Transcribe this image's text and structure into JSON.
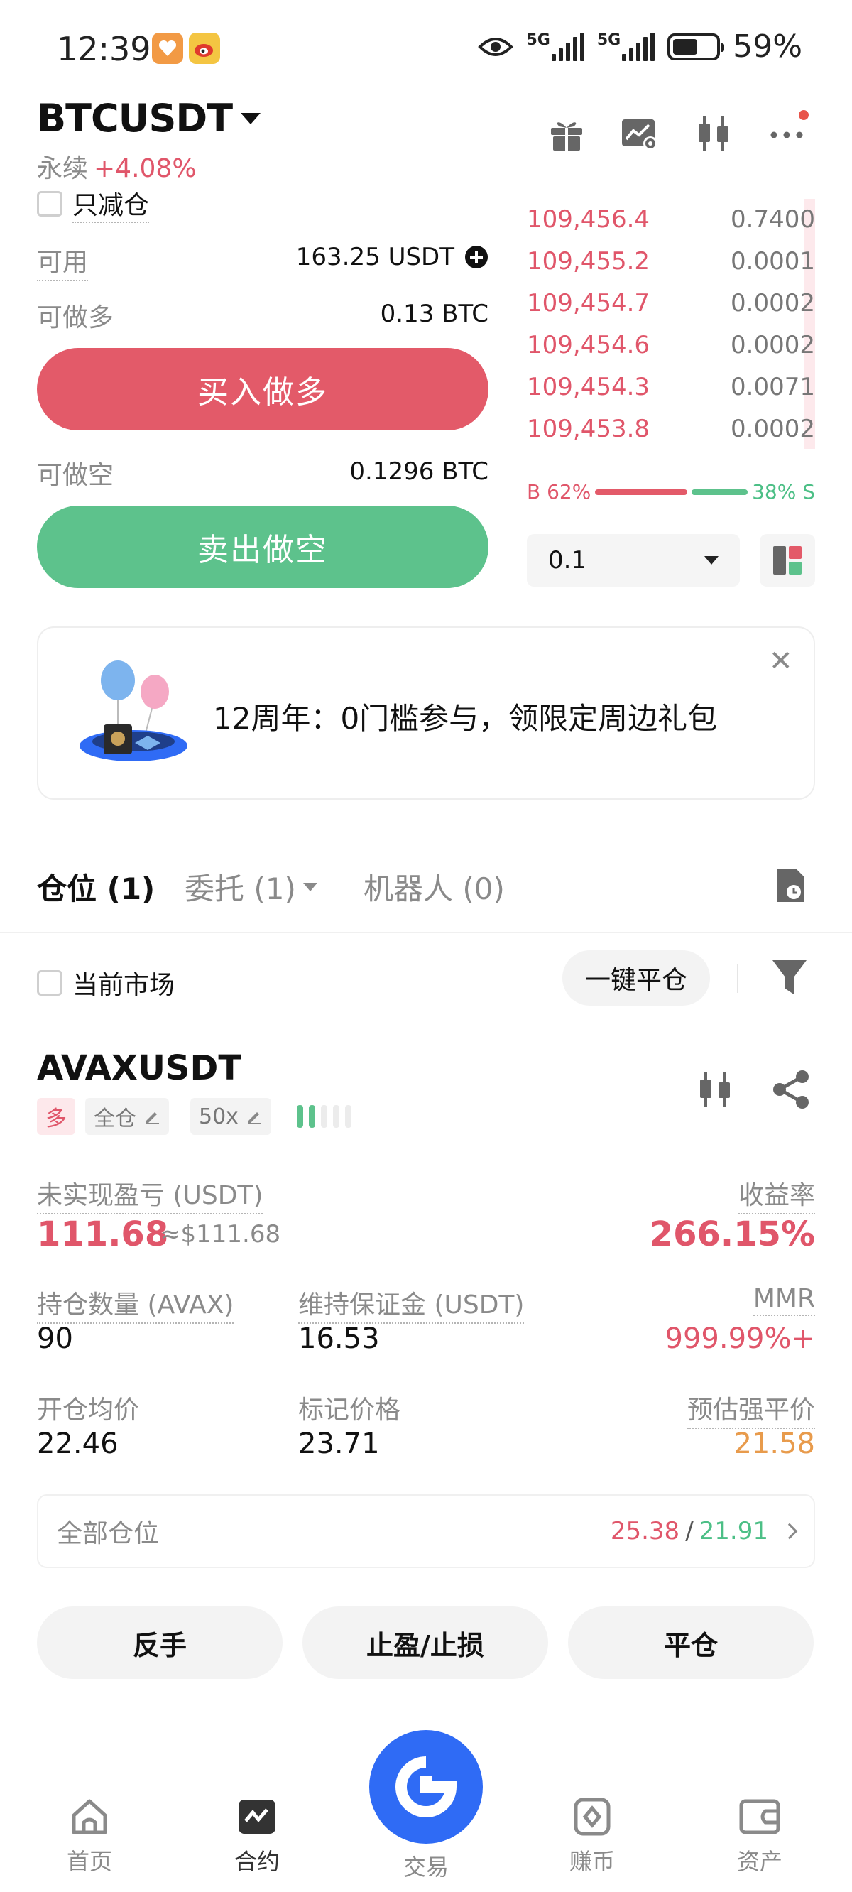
{
  "status_bar": {
    "time": "12:39",
    "network1": "5G",
    "network2": "5G",
    "battery": "59%",
    "battery_level": 0.59
  },
  "header": {
    "pair": "BTCUSDT",
    "contract_type": "永续",
    "change": "+4.08%"
  },
  "reduce_only": {
    "label": "只减仓",
    "checked": false
  },
  "balance": {
    "available_label": "可用",
    "available_value": "163.25 USDT",
    "long_label": "可做多",
    "long_value": "0.13 BTC",
    "short_label": "可做空",
    "short_value": "0.1296 BTC"
  },
  "buttons": {
    "buy": "买入做多",
    "sell": "卖出做空"
  },
  "order_book": {
    "asks": [
      {
        "price": "109,456.4",
        "qty": "0.7400"
      },
      {
        "price": "109,455.2",
        "qty": "0.0001"
      },
      {
        "price": "109,454.7",
        "qty": "0.0002"
      },
      {
        "price": "109,454.6",
        "qty": "0.0002"
      },
      {
        "price": "109,454.3",
        "qty": "0.0071"
      },
      {
        "price": "109,453.8",
        "qty": "0.0002"
      }
    ],
    "buy_ratio_label": "B 62%",
    "sell_ratio_label": "38% S",
    "buy_ratio": 0.62,
    "precision": "0.1"
  },
  "banner": {
    "text": "12周年：0门槛参与，领限定周边礼包"
  },
  "tabs": {
    "positions": "仓位 (1)",
    "orders": "委托 (1)",
    "bots": "机器人 (0)"
  },
  "filter": {
    "current_market": "当前市场",
    "close_all": "一键平仓"
  },
  "position": {
    "symbol": "AVAXUSDT",
    "side": "多",
    "margin_mode": "全仓",
    "leverage": "50x",
    "risk_level": 2,
    "risk_total": 5,
    "pnl_label": "未实现盈亏 (USDT)",
    "pnl_value": "111.68",
    "pnl_usd": "≈$111.68",
    "roe_label": "收益率",
    "roe_value": "266.15%",
    "size_label": "持仓数量 (AVAX)",
    "size_value": "90",
    "margin_label": "维持保证金 (USDT)",
    "margin_value": "16.53",
    "mmr_label": "MMR",
    "mmr_value": "999.99%+",
    "entry_label": "开仓均价",
    "entry_value": "22.46",
    "mark_label": "标记价格",
    "mark_value": "23.71",
    "liq_label": "预估强平价",
    "liq_value": "21.58"
  },
  "all_positions": {
    "label": "全部仓位",
    "value_red": "25.38",
    "separator": " / ",
    "value_green": "21.91"
  },
  "actions": {
    "reverse": "反手",
    "tpsl": "止盈/止损",
    "close": "平仓"
  },
  "nav": {
    "home": "首页",
    "futures": "合约",
    "trade": "交易",
    "earn": "赚币",
    "assets": "资产"
  },
  "colors": {
    "red": "#e35a69",
    "green": "#5dc28c",
    "brand_blue": "#2f6bf5"
  }
}
